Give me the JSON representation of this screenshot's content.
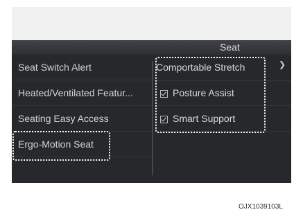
{
  "header": {
    "title": "Seat"
  },
  "left_menu": {
    "items": [
      "Seat Switch Alert",
      "Heated/Ventilated Featur...",
      "Seating Easy Access",
      "Ergo-Motion Seat"
    ]
  },
  "right_menu": {
    "items": [
      {
        "label": "Comportable Stretch",
        "checkbox": false
      },
      {
        "label": "Posture Assist",
        "checkbox": true,
        "checked": true
      },
      {
        "label": "Smart Support",
        "checkbox": true,
        "checked": true
      }
    ]
  },
  "chevron_icon": "chevron-right-icon",
  "caption": "OJX1039103L"
}
